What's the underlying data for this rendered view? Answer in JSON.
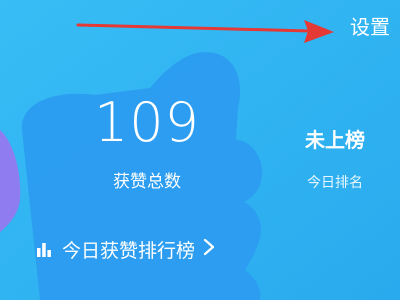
{
  "header": {
    "settings_label": "设置"
  },
  "stats": {
    "likes_total": "109",
    "likes_total_label": "获赞总数",
    "today_rank": "未上榜",
    "today_rank_label": "今日排名"
  },
  "leaderboard": {
    "label": "今日获赞排行榜"
  },
  "icons": {
    "arrow": "arrow-right-icon",
    "leaderboard": "bar-chart-icon",
    "chevron": "chevron-right-icon"
  },
  "colors": {
    "background": "#2fb3f2",
    "thumb_shape": "#2c9cf0",
    "purple_accent": "#8f7cf0",
    "arrow_red": "#e53935",
    "text": "#ffffff"
  }
}
